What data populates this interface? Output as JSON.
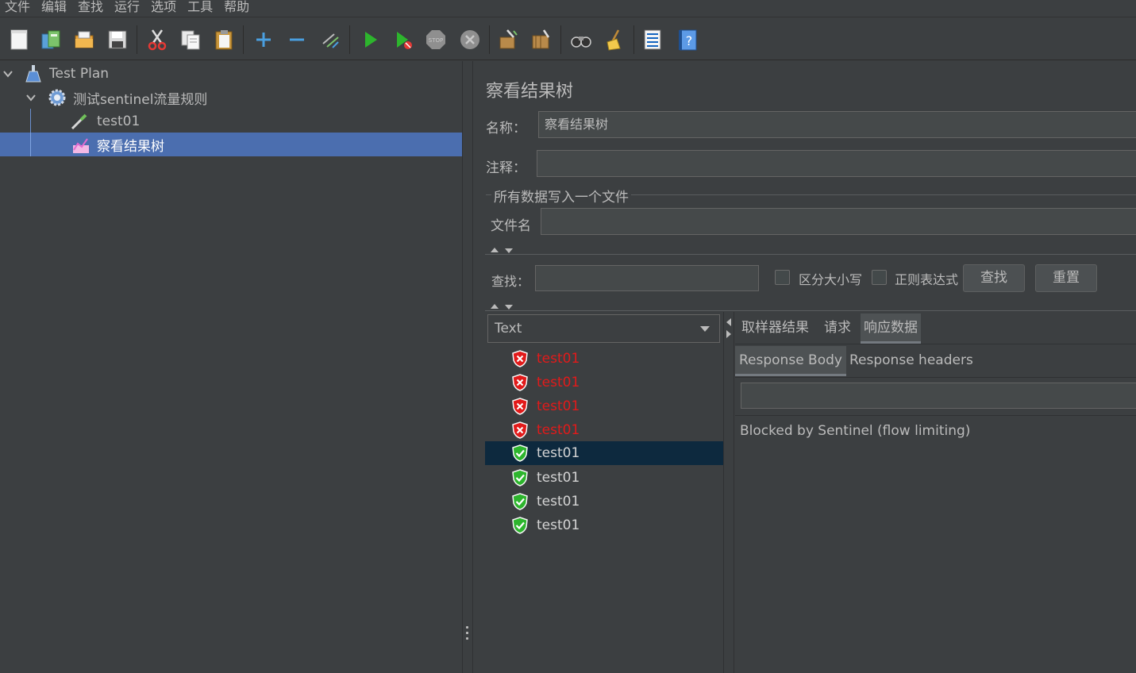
{
  "menubar": {
    "items": [
      "文件",
      "编辑",
      "查找",
      "运行",
      "选项",
      "工具",
      "帮助"
    ]
  },
  "toolbar": {
    "buttons": [
      {
        "name": "new-icon"
      },
      {
        "name": "templates-icon"
      },
      {
        "name": "open-icon"
      },
      {
        "name": "save-icon"
      },
      {
        "name": "cut-icon"
      },
      {
        "name": "copy-icon"
      },
      {
        "name": "paste-icon"
      },
      {
        "name": "expand-all-icon"
      },
      {
        "name": "collapse-all-icon"
      },
      {
        "name": "toggle-icon"
      },
      {
        "name": "start-icon"
      },
      {
        "name": "start-no-pause-icon"
      },
      {
        "name": "stop-icon"
      },
      {
        "name": "shutdown-icon"
      },
      {
        "name": "clear-icon"
      },
      {
        "name": "clear-all-icon"
      },
      {
        "name": "search-icon"
      },
      {
        "name": "reset-search-icon"
      },
      {
        "name": "function-helper-icon"
      },
      {
        "name": "help-icon"
      }
    ]
  },
  "tree": {
    "items": [
      {
        "label": "Test Plan",
        "icon": "test-plan-icon"
      },
      {
        "label": "测试sentinel流量规则",
        "icon": "thread-group-gear-icon"
      },
      {
        "label": "test01",
        "icon": "sampler-pipette-icon"
      },
      {
        "label": "察看结果树",
        "icon": "listener-chart-icon"
      }
    ],
    "selected_index": 3
  },
  "panel": {
    "title": "察看结果树",
    "name_label": "名称：",
    "name_value": "察看结果树",
    "comment_label": "注释：",
    "comment_value": "",
    "file_section_title": "所有数据写入一个文件",
    "filename_label": "文件名",
    "filename_value": ""
  },
  "search": {
    "label": "查找：",
    "value": "",
    "case_sensitive_label": "区分大小写",
    "regex_label": "正则表达式",
    "find_button": "查找",
    "reset_button": "重置"
  },
  "results": {
    "renderer": "Text",
    "items": [
      {
        "label": "test01",
        "status": "fail"
      },
      {
        "label": "test01",
        "status": "fail"
      },
      {
        "label": "test01",
        "status": "fail"
      },
      {
        "label": "test01",
        "status": "fail"
      },
      {
        "label": "test01",
        "status": "success"
      },
      {
        "label": "test01",
        "status": "success"
      },
      {
        "label": "test01",
        "status": "success"
      },
      {
        "label": "test01",
        "status": "success"
      }
    ],
    "selected_index": 4
  },
  "detail": {
    "tabs": [
      "取样器结果",
      "请求",
      "响应数据"
    ],
    "active_tab": "响应数据",
    "subtabs": [
      "Response Body",
      "Response headers"
    ],
    "active_subtab": "Response Body",
    "body_text": "Blocked by Sentinel (flow limiting)"
  },
  "colors": {
    "background": "#3c3f41",
    "selection": "#4b6eaf",
    "fail_text": "#e21a1a",
    "list_selection": "#0d293e"
  }
}
